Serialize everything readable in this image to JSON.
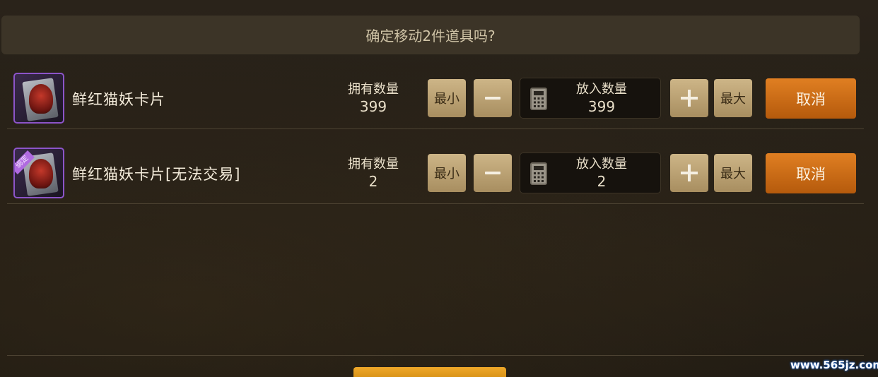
{
  "dialog": {
    "title": "确定移动2件道具吗?"
  },
  "items": [
    {
      "name": "鲜红猫妖卡片",
      "bound": false,
      "owned_label": "拥有数量",
      "owned_value": "399",
      "min_label": "最小",
      "max_label": "最大",
      "qty_label": "放入数量",
      "qty_value": "399",
      "cancel_label": "取消"
    },
    {
      "name": "鲜红猫妖卡片[无法交易]",
      "bound": true,
      "bound_tag": "绑定",
      "owned_label": "拥有数量",
      "owned_value": "2",
      "min_label": "最小",
      "max_label": "最大",
      "qty_label": "放入数量",
      "qty_value": "2",
      "cancel_label": "取消"
    }
  ],
  "watermark": "www.565jz.com",
  "colors": {
    "accent_cancel": "#d46d14",
    "button_tan": "#bba274",
    "icon_border": "#8c54c9",
    "confirm_button": "#e59c1e"
  },
  "icons": {
    "item_icon": "cat-demon-card-icon",
    "qty_icon": "calculator-icon"
  }
}
